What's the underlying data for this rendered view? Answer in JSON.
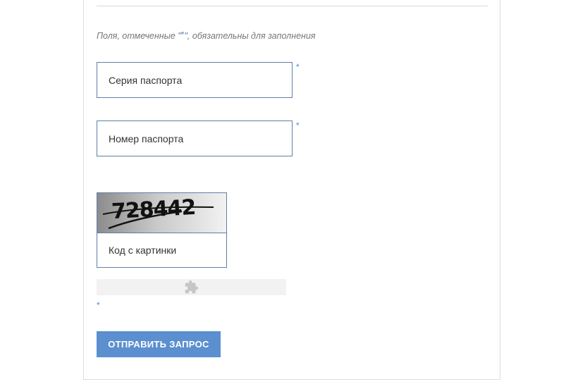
{
  "form": {
    "required_note_prefix": "Поля, отмеченные \"",
    "required_note_asterisk": "*",
    "required_note_suffix": "\", обязательны для заполнения",
    "required_marker": "*",
    "fields": [
      {
        "placeholder": "Серия паспорта",
        "value": ""
      },
      {
        "placeholder": "Номер паспорта",
        "value": ""
      }
    ],
    "captcha": {
      "image_text": "728442",
      "placeholder": "Код с картинки",
      "value": ""
    },
    "widget_icon": "puzzle-piece-icon",
    "submit_label": "ОТПРАВИТЬ ЗАПРОС"
  },
  "colors": {
    "accent": "#5b8fd0",
    "required_marker": "#4a86d1",
    "field_border": "#5f7fa6"
  }
}
